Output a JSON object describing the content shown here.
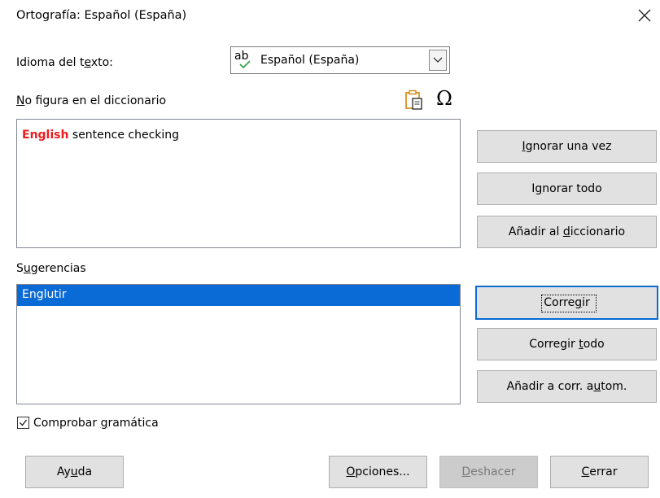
{
  "window": {
    "title": "Ortografía: Español (España)",
    "close_icon": "close-icon"
  },
  "language": {
    "label_pre": "Idioma del t",
    "label_key": "e",
    "label_post": "xto:",
    "icon_text": "ab",
    "value": "Español (España)"
  },
  "not_in_dict": {
    "label_key": "N",
    "label_post": "o figura en el diccionario",
    "paste_icon": "paste-icon",
    "special_char_icon": "omega-icon",
    "omega_glyph": "Ω",
    "error_word": "English",
    "rest_text": " sentence checking"
  },
  "suggestions": {
    "label_pre": "S",
    "label_key": "u",
    "label_post": "gerencias",
    "items": [
      "Englutir"
    ],
    "selected_index": 0
  },
  "buttons": {
    "ignore_once": {
      "pre": "",
      "key": "I",
      "post": "gnorar una vez"
    },
    "ignore_all": {
      "pre": "I",
      "key": "g",
      "post": "norar todo"
    },
    "add_dict": {
      "pre": "Añadir al ",
      "key": "d",
      "post": "iccionario"
    },
    "correct": {
      "pre": "Corre",
      "key": "g",
      "post": "ir"
    },
    "correct_all": {
      "pre": "Corregir ",
      "key": "t",
      "post": "odo"
    },
    "autocorrect": {
      "pre": "Añadir a corr. a",
      "key": "u",
      "post": "tom."
    },
    "help": {
      "pre": "Ay",
      "key": "u",
      "post": "da"
    },
    "options": {
      "pre": "",
      "key": "O",
      "post": "pciones..."
    },
    "undo": {
      "pre": "",
      "key": "D",
      "post": "eshacer"
    },
    "close": {
      "pre": "",
      "key": "C",
      "post": "errar"
    }
  },
  "grammar_check": {
    "checked": true,
    "label_pre": "Comprobar ",
    "label_key": "g",
    "label_post": "ramática"
  },
  "colors": {
    "selection": "#0a6bd6",
    "error_text": "#ee1c1c",
    "button_face": "#e1e1e1"
  }
}
